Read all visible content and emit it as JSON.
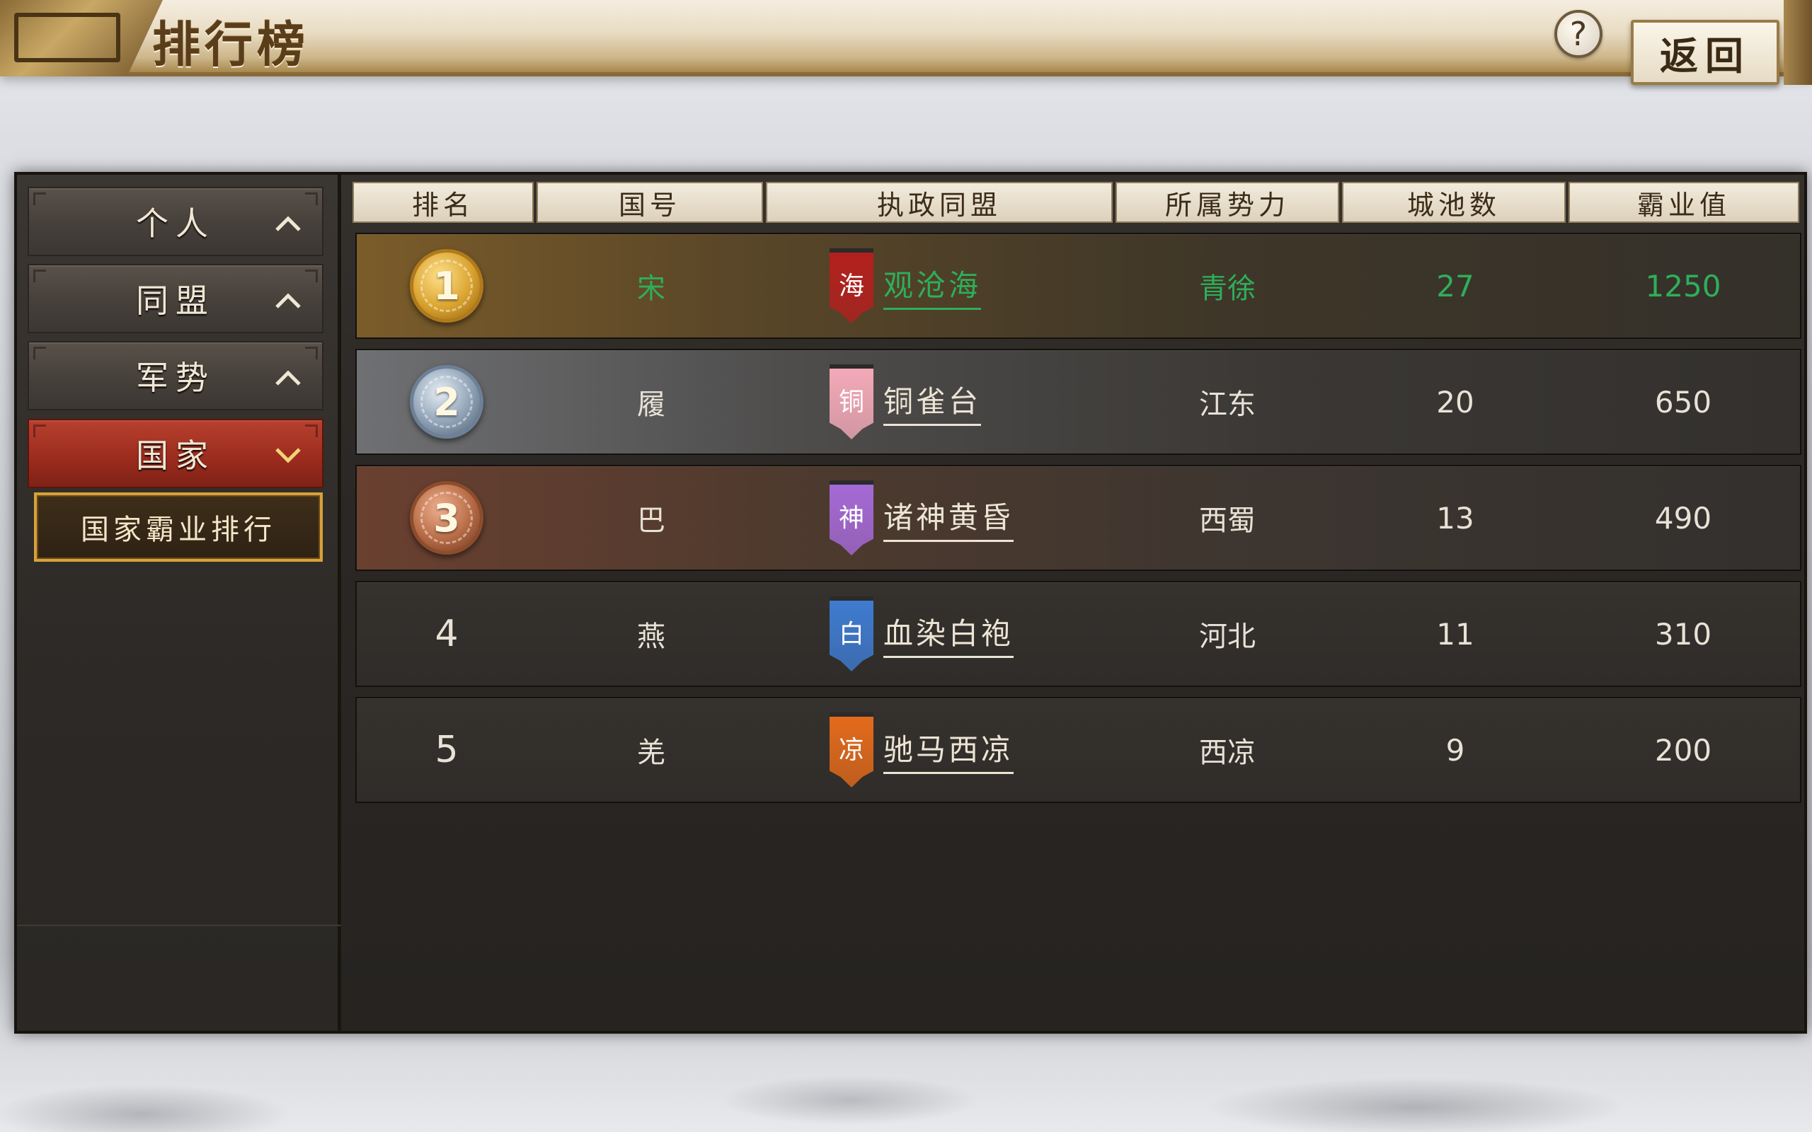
{
  "header": {
    "title": "排行榜",
    "help_label": "?",
    "back_label": "返回"
  },
  "sidebar": {
    "items": [
      {
        "label": "个人",
        "chevron": "chevron-up-icon",
        "active": false
      },
      {
        "label": "同盟",
        "chevron": "chevron-up-icon",
        "active": false
      },
      {
        "label": "军势",
        "chevron": "chevron-up-icon",
        "active": false
      },
      {
        "label": "国家",
        "chevron": "chevron-down-icon",
        "active": true
      }
    ],
    "sub_item": {
      "label": "国家霸业排行"
    }
  },
  "table": {
    "columns": [
      "排名",
      "国号",
      "执政同盟",
      "所属势力",
      "城池数",
      "霸业值"
    ],
    "rows": [
      {
        "rank": "1",
        "code": "宋",
        "banner_char": "海",
        "banner_color": "#b3201e",
        "alliance": "观沧海",
        "force": "青徐",
        "cities": "27",
        "score": "1250",
        "highlight": true
      },
      {
        "rank": "2",
        "code": "履",
        "banner_char": "铜",
        "banner_color": "#f3a9b8",
        "alliance": "铜雀台",
        "force": "江东",
        "cities": "20",
        "score": "650",
        "highlight": false
      },
      {
        "rank": "3",
        "code": "巴",
        "banner_char": "神",
        "banner_color": "#a56ad6",
        "alliance": "诸神黄昏",
        "force": "西蜀",
        "cities": "13",
        "score": "490",
        "highlight": false
      },
      {
        "rank": "4",
        "code": "燕",
        "banner_char": "白",
        "banner_color": "#3f7bd0",
        "alliance": "血染白袍",
        "force": "河北",
        "cities": "11",
        "score": "310",
        "highlight": false
      },
      {
        "rank": "5",
        "code": "羌",
        "banner_char": "凉",
        "banner_color": "#e26a1c",
        "alliance": "驰马西凉",
        "force": "西凉",
        "cities": "9",
        "score": "200",
        "highlight": false
      }
    ]
  },
  "colors": {
    "highlight_text": "#2fae5a",
    "active_tab": "#9a2b1d",
    "sub_item_border": "#d6a23a"
  }
}
